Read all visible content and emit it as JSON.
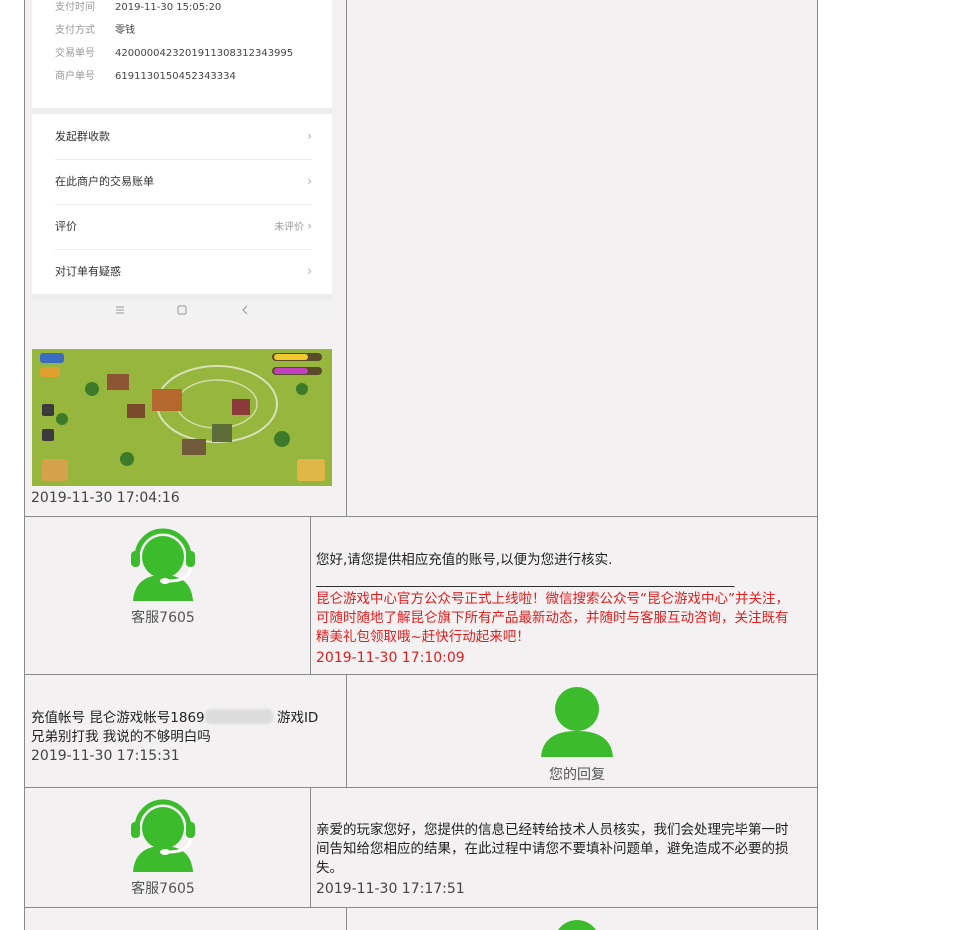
{
  "receipt": {
    "rows": [
      {
        "label": "支付时间",
        "value": "2019-11-30 15:05:20"
      },
      {
        "label": "支付方式",
        "value": "零钱"
      },
      {
        "label": "交易单号",
        "value": "4200000423201911308312343995"
      },
      {
        "label": "商户单号",
        "value": "6191130150452343334"
      }
    ],
    "menu": [
      {
        "label": "发起群收款",
        "extra": ""
      },
      {
        "label": "在此商户的交易账单",
        "extra": ""
      },
      {
        "label": "评价",
        "extra": "未评价"
      },
      {
        "label": "对订单有疑惑",
        "extra": ""
      }
    ],
    "nav_icons": [
      "menu-icon",
      "home-icon",
      "back-icon"
    ]
  },
  "messages": [
    {
      "side": "user",
      "time": "2019-11-30 17:04:16"
    },
    {
      "side": "agent",
      "name": "客服7605",
      "text": "您好,请您提供相应充值的账号,以便为您进行核实.",
      "divider": "______________________________________________________________",
      "promo": "昆仑游戏中心官方公众号正式上线啦！微信搜索公众号“昆仑游戏中心”并关注，可随时随地了解昆仑旗下所有产品最新动态，并随时与客服互动咨询，关注既有精美礼包领取哦~赶快行动起来吧！",
      "time": "2019-11-30 17:10:09"
    },
    {
      "side": "user",
      "name": "您的回复",
      "text_a": "充值帐号 昆仑游戏帐号1869",
      "text_b": " 游戏ID 兄弟别打我 我说的不够明白吗",
      "time": "2019-11-30 17:15:31"
    },
    {
      "side": "agent",
      "name": "客服7605",
      "text": "亲爱的玩家您好，您提供的信息已经转给技术人员核实，我们会处理完毕第一时间告知给您相应的结果，在此过程中请您不要填补问题单，避免造成不必要的损失。",
      "time": "2019-11-30 17:17:51"
    }
  ],
  "colors": {
    "avatar_green": "#3cbb2c",
    "promo_red": "#e02020",
    "panel": "#f3f1f2",
    "border": "#8a8a8a"
  }
}
